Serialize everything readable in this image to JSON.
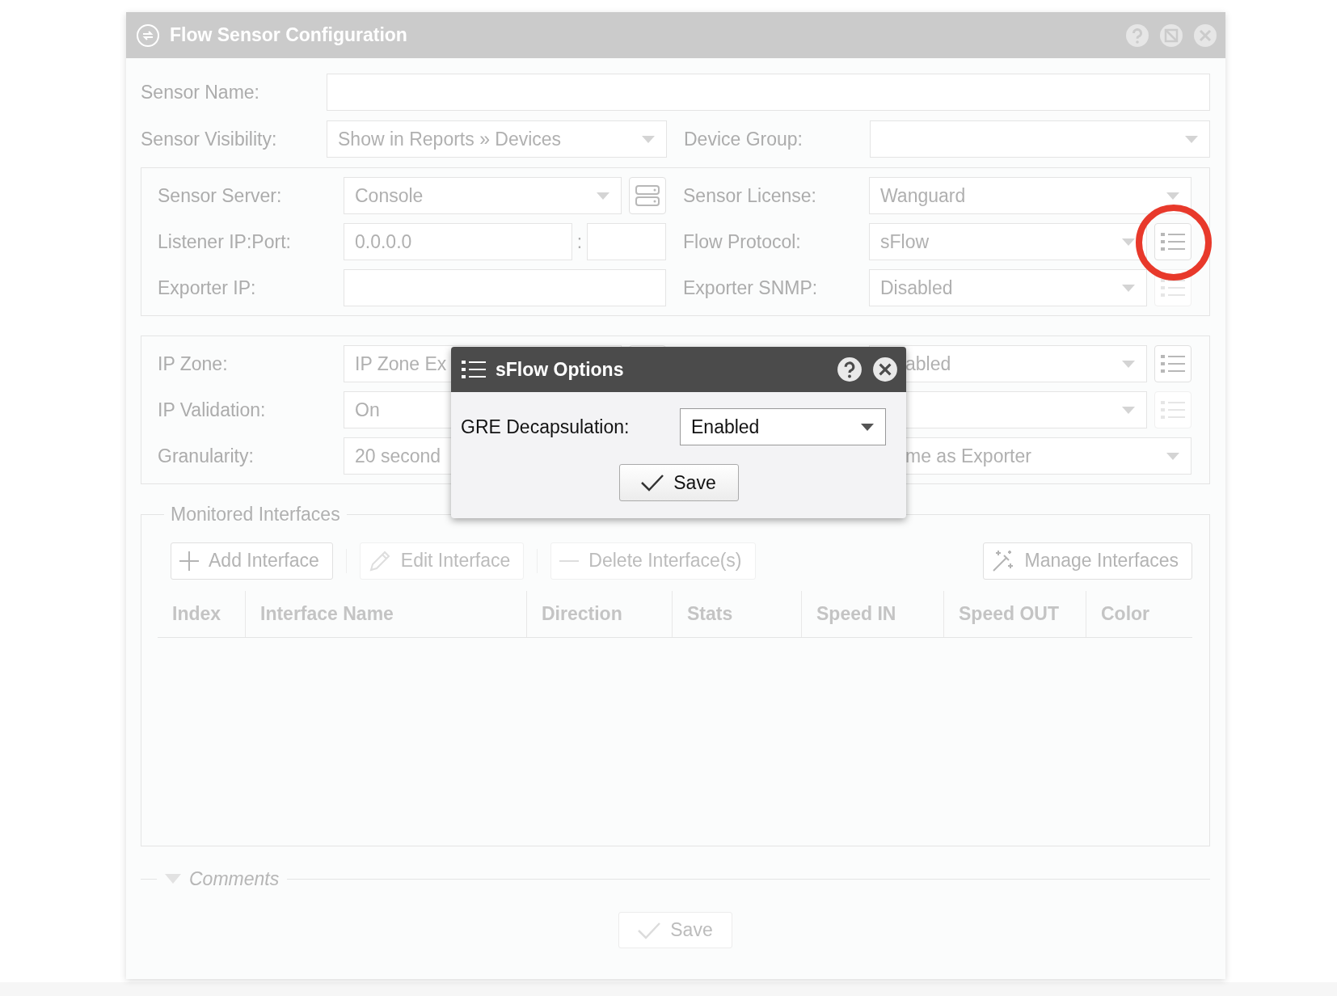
{
  "window": {
    "title": "Flow Sensor Configuration"
  },
  "top_rows": [
    {
      "left": {
        "label": "Sensor Name:",
        "kind": "text"
      }
    },
    {
      "left": {
        "label": "Sensor Visibility:",
        "kind": "select",
        "value": "Show in Reports » Devices"
      },
      "right": {
        "label": "Device Group:",
        "kind": "select"
      }
    }
  ],
  "groups": [
    {
      "rows": [
        {
          "left": {
            "label": "Sensor Server:",
            "kind": "select",
            "value": "Console",
            "button": {
              "kind": "server",
              "disabled": false
            }
          },
          "right": {
            "label": "Sensor License:",
            "kind": "select",
            "value": "Wanguard"
          }
        },
        {
          "left": {
            "label": "Listener IP:Port:",
            "kind": "ip_port",
            "value": "0.0.0.0",
            "separator": ":"
          },
          "right": {
            "label": "Flow Protocol:",
            "kind": "select",
            "value": "sFlow",
            "button": {
              "kind": "list",
              "disabled": false
            }
          }
        },
        {
          "left": {
            "label": "Exporter IP:",
            "kind": "text"
          },
          "right": {
            "label": "Exporter SNMP:",
            "kind": "select",
            "value": "Disabled",
            "button": {
              "kind": "list",
              "disabled": true
            }
          }
        }
      ]
    },
    {
      "rows": [
        {
          "left": {
            "label": "IP Zone:",
            "kind": "text",
            "value": "IP Zone Ex",
            "button": {
              "kind": "list",
              "disabled": false
            }
          },
          "right": {
            "kind": "select",
            "value": "abled",
            "button": {
              "kind": "list",
              "disabled": false
            }
          }
        },
        {
          "left": {
            "label": "IP Validation:",
            "kind": "select",
            "value": "On"
          },
          "right": {
            "kind": "select",
            "button": {
              "kind": "list",
              "disabled": true
            }
          }
        },
        {
          "left": {
            "label": "Granularity:",
            "kind": "select",
            "value": "20 second"
          },
          "right": {
            "kind": "select",
            "value": "me as Exporter"
          }
        }
      ]
    }
  ],
  "interfaces": {
    "legend": "Monitored Interfaces",
    "toolbar": [
      {
        "label": "Add Interface",
        "kind": "add",
        "disabled": false
      },
      {
        "label": "Edit Interface",
        "kind": "edit",
        "disabled": true
      },
      {
        "label": "Delete Interface(s)",
        "kind": "delete",
        "disabled": true
      },
      {
        "label": "Manage Interfaces",
        "kind": "manage",
        "disabled": false
      }
    ],
    "columns": [
      "Index",
      "Interface Name",
      "Direction",
      "Stats",
      "Speed IN",
      "Speed OUT",
      "Color"
    ]
  },
  "comments": {
    "label": "Comments"
  },
  "footer": {
    "save": {
      "label": "Save",
      "disabled": true
    }
  },
  "popup": {
    "title": "sFlow Options",
    "fields": [
      {
        "label": "GRE Decapsulation:",
        "value": "Enabled"
      }
    ],
    "save": {
      "label": "Save"
    }
  }
}
